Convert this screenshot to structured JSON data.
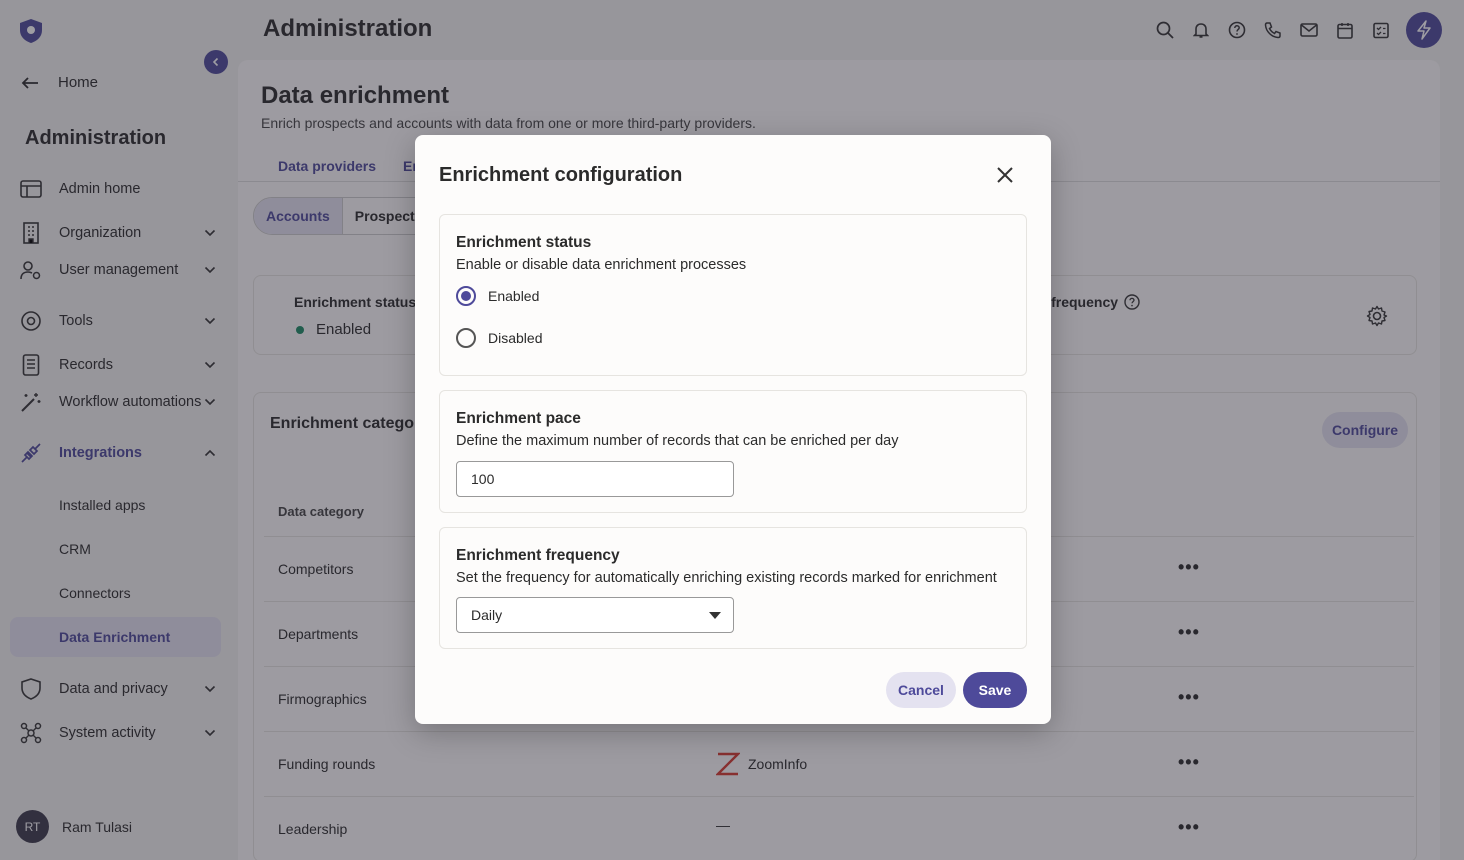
{
  "app": {
    "title": "Administration"
  },
  "sidebar": {
    "home": "Home",
    "title": "Administration",
    "items": [
      {
        "label": "Admin home",
        "icon": "layout-icon"
      },
      {
        "label": "Organization",
        "icon": "building-icon"
      },
      {
        "label": "User management",
        "icon": "user-gear-icon"
      },
      {
        "label": "Tools",
        "icon": "tools-icon"
      },
      {
        "label": "Records",
        "icon": "records-icon"
      },
      {
        "label": "Workflow automations",
        "icon": "wand-icon"
      },
      {
        "label": "Integrations",
        "icon": "plug-icon"
      },
      {
        "label": "Data and privacy",
        "icon": "shield-icon"
      },
      {
        "label": "System activity",
        "icon": "network-icon"
      }
    ],
    "integrations_sub": [
      "Installed apps",
      "CRM",
      "Connectors",
      "Data Enrichment"
    ],
    "user": {
      "initials": "RT",
      "name": "Ram Tulasi"
    }
  },
  "page": {
    "title": "Data enrichment",
    "subtitle": "Enrich prospects and accounts with data from one or more third-party providers.",
    "tabs": [
      "Data providers",
      "Er"
    ],
    "segments": [
      "Accounts",
      "Prospects"
    ],
    "status_card": {
      "label": "Enrichment status",
      "value": "Enabled",
      "freq_label_partial": "nt frequency"
    },
    "categories_card": {
      "title": "Enrichment catego",
      "configure": "Configure",
      "column": "Data category",
      "rows": [
        {
          "name": "Competitors",
          "provider": ""
        },
        {
          "name": "Departments",
          "provider": ""
        },
        {
          "name": "Firmographics",
          "provider": ""
        },
        {
          "name": "Funding rounds",
          "provider": "ZoomInfo"
        },
        {
          "name": "Leadership",
          "provider": "—"
        }
      ],
      "more": "•••"
    }
  },
  "modal": {
    "title": "Enrichment configuration",
    "status": {
      "heading": "Enrichment status",
      "description": "Enable or disable data enrichment processes",
      "options": [
        "Enabled",
        "Disabled"
      ],
      "selected": "Enabled"
    },
    "pace": {
      "heading": "Enrichment pace",
      "description": "Define the maximum number of records that can be enriched per day",
      "value": "100"
    },
    "frequency": {
      "heading": "Enrichment frequency",
      "description": "Set the frequency for automatically enriching existing records marked for enrichment",
      "value": "Daily"
    },
    "cancel": "Cancel",
    "save": "Save"
  },
  "colors": {
    "accent": "#4e4a9a",
    "accent_light": "#e4e2f0",
    "status_green": "#1d8a63"
  }
}
